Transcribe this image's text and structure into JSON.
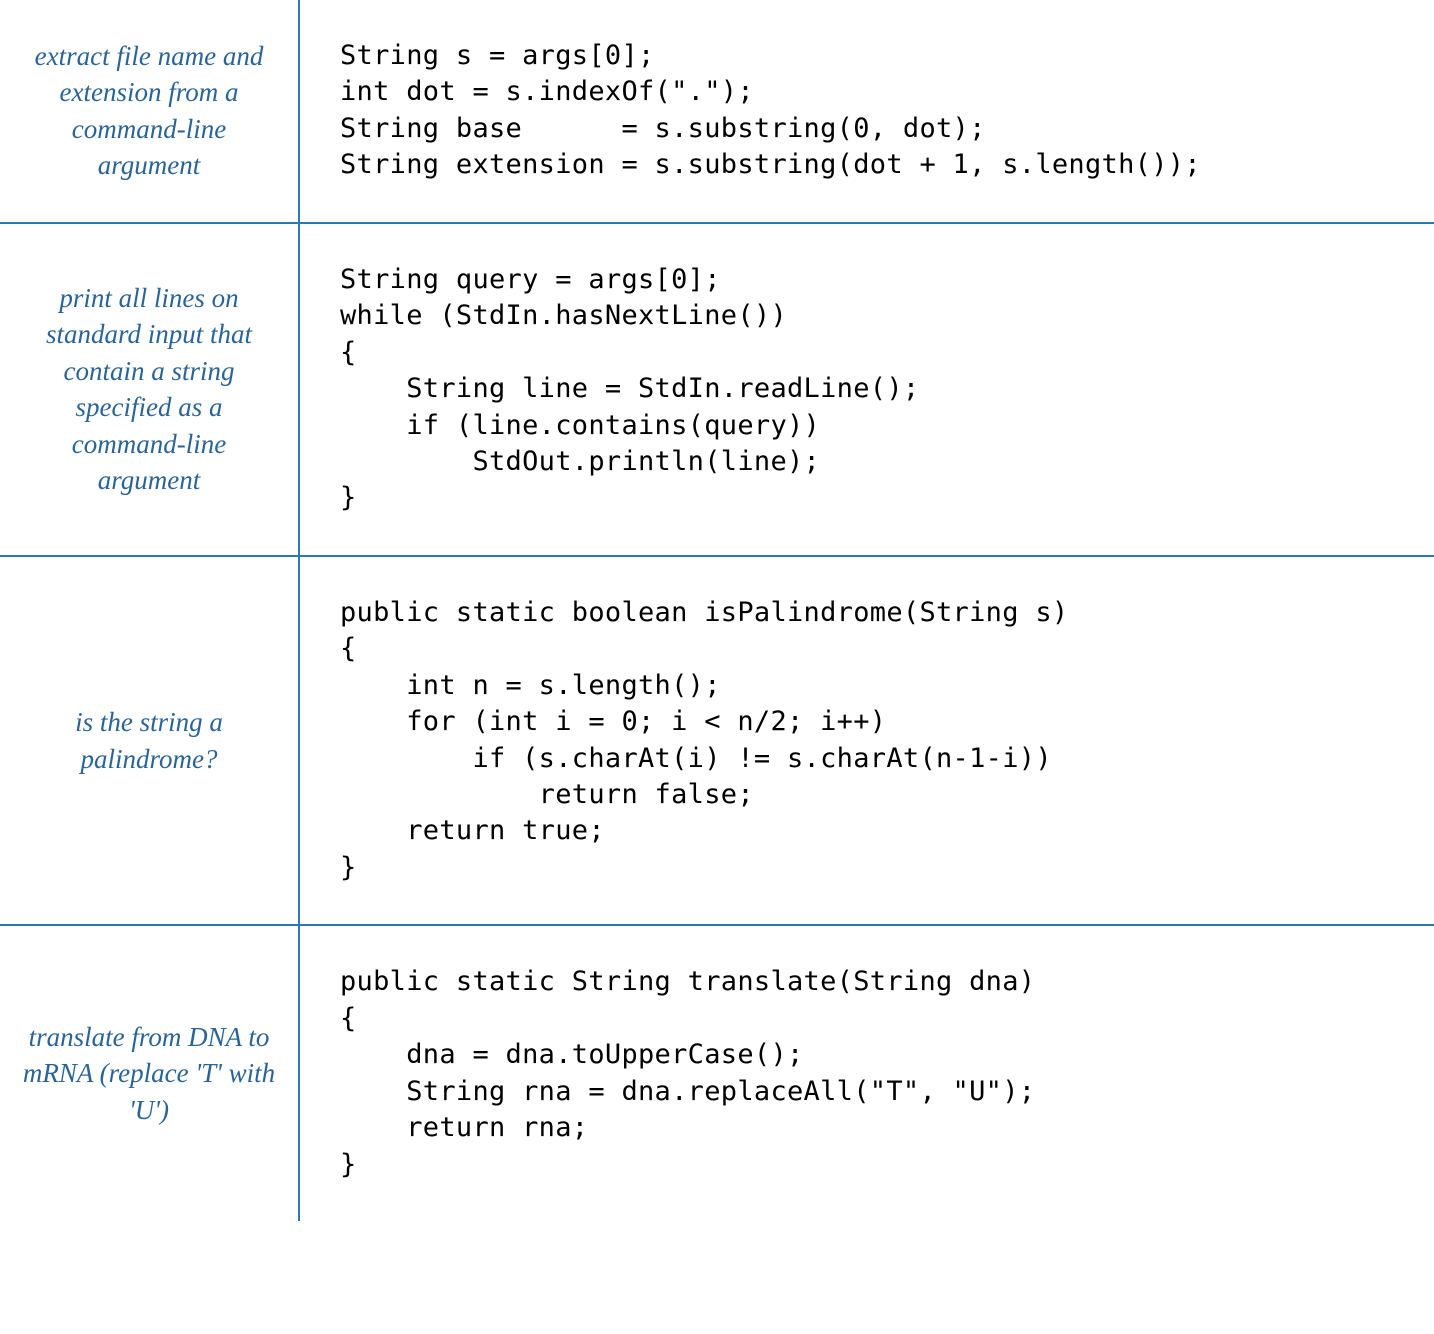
{
  "rows": [
    {
      "description": "extract file name\nand extension from a\ncommand-line\nargument",
      "code": "String s = args[0];\nint dot = s.indexOf(\".\");\nString base      = s.substring(0, dot);\nString extension = s.substring(dot + 1, s.length());"
    },
    {
      "description": "print all lines on\nstandard input\nthat contain a string\nspecified as a\ncommand-line\nargument",
      "code": "String query = args[0];\nwhile (StdIn.hasNextLine())\n{\n    String line = StdIn.readLine();\n    if (line.contains(query))\n        StdOut.println(line);\n}"
    },
    {
      "description": "is the string\na palindrome?",
      "code": "public static boolean isPalindrome(String s)\n{\n    int n = s.length();\n    for (int i = 0; i < n/2; i++)\n        if (s.charAt(i) != s.charAt(n-1-i))\n            return false;\n    return true;\n}"
    },
    {
      "description": "translate from\nDNA to mRNA\n(replace 'T' with 'U')",
      "code": "public static String translate(String dna)\n{\n    dna = dna.toUpperCase();\n    String rna = dna.replaceAll(\"T\", \"U\");\n    return rna;\n}"
    }
  ]
}
